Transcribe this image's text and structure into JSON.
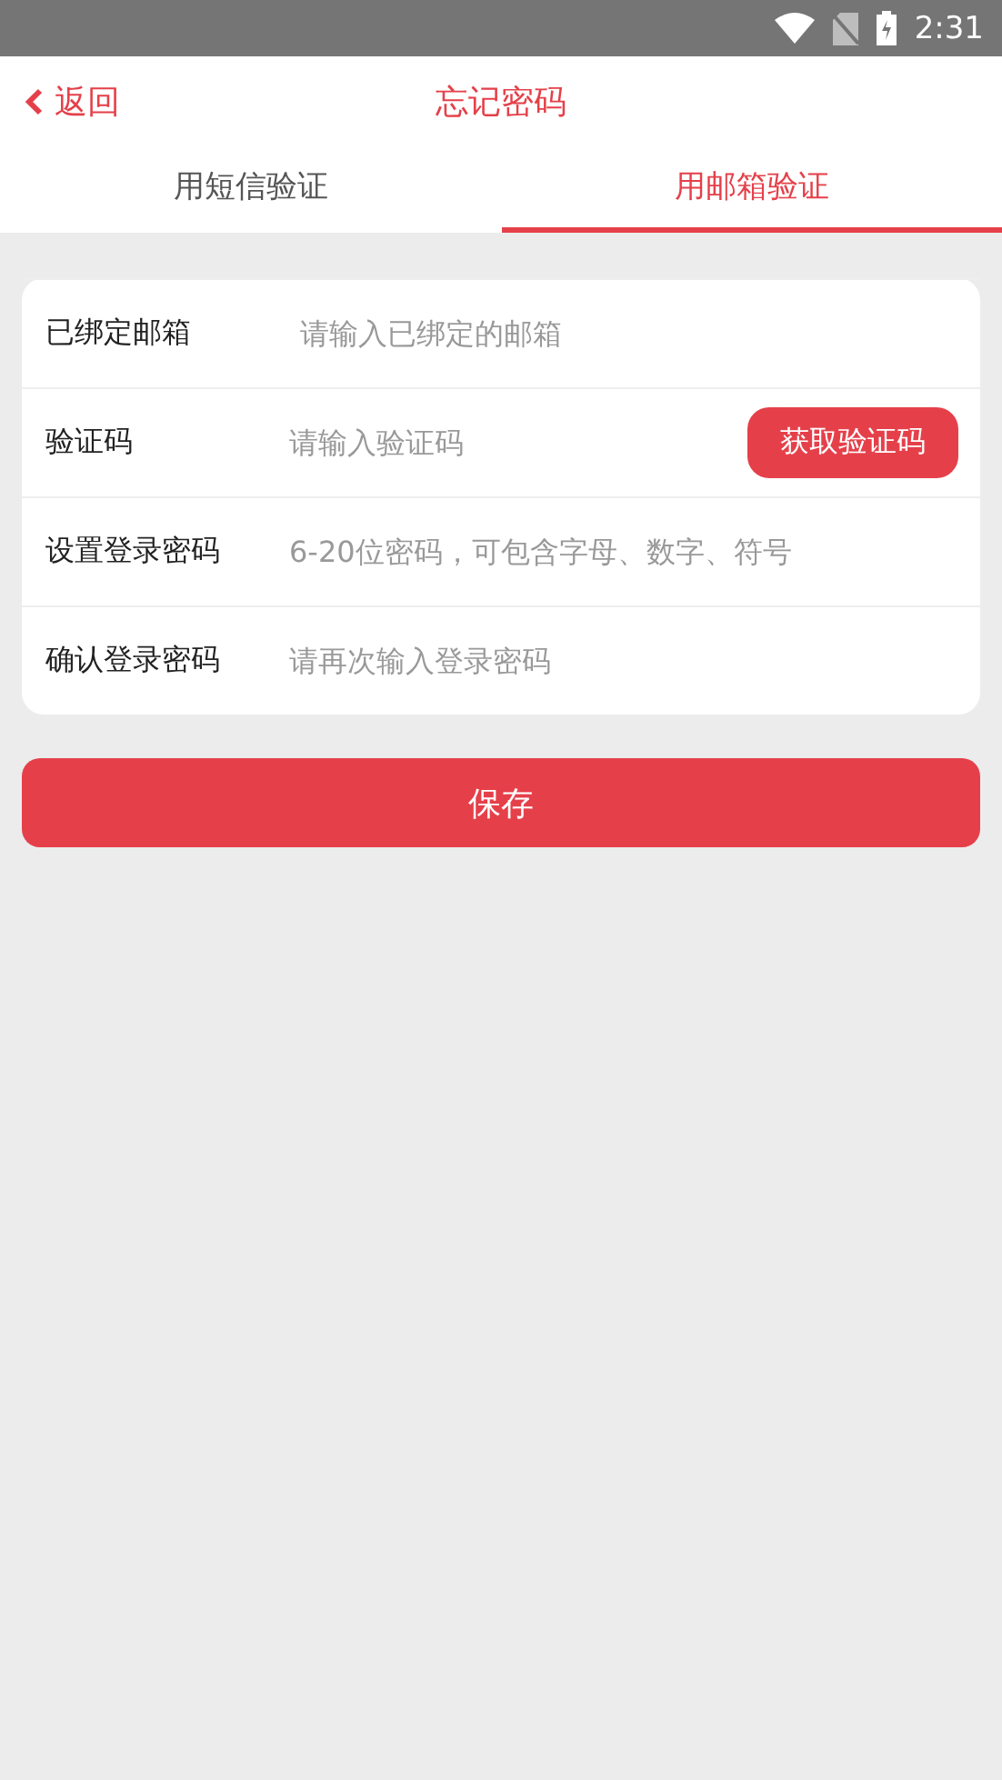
{
  "status_bar": {
    "time": "2:31"
  },
  "header": {
    "back": "返回",
    "title": "忘记密码"
  },
  "tabs": [
    {
      "label": "用短信验证",
      "selected": false
    },
    {
      "label": "用邮箱验证",
      "selected": true
    }
  ],
  "form": [
    {
      "kind": "text",
      "label": "已绑定邮箱",
      "placeholder": "请输入已绑定的邮箱"
    },
    {
      "kind": "code",
      "label": "验证码",
      "placeholder": "请输入验证码",
      "button": "获取验证码"
    },
    {
      "kind": "text",
      "label": "设置登录密码",
      "placeholder": "6-20位密码，可包含字母、数字、符号"
    },
    {
      "kind": "text",
      "label": "确认登录密码",
      "placeholder": "请再次输入登录密码"
    }
  ],
  "save_button": "保存"
}
